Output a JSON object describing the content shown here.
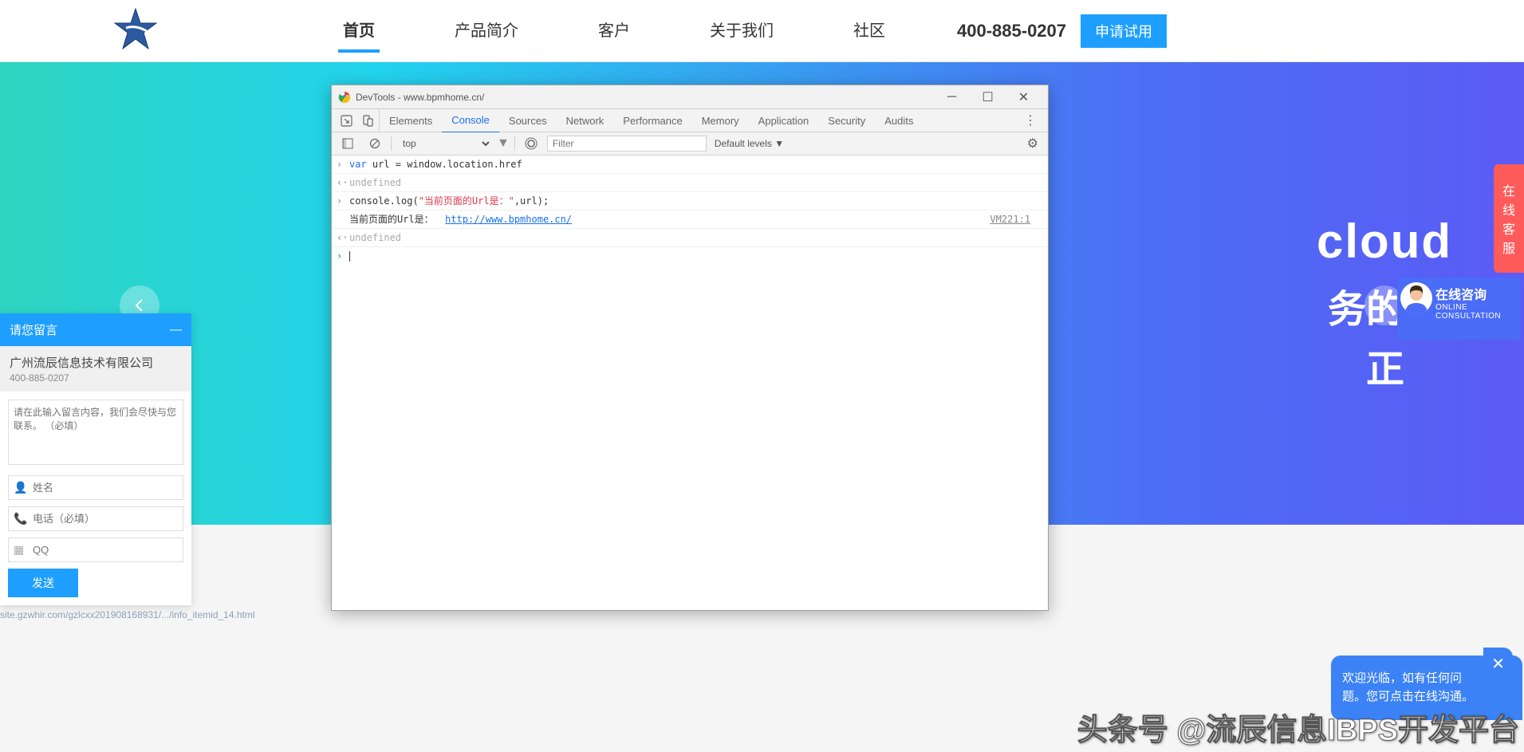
{
  "header": {
    "nav": [
      "首页",
      "产品简介",
      "客户",
      "关于我们",
      "社区"
    ],
    "phone": "400-885-0207",
    "trial": "申请试用"
  },
  "hero": {
    "line1": "cloud",
    "line2": "务的",
    "line3": "正"
  },
  "devtools": {
    "title": "DevTools - www.bpmhome.cn/",
    "tabs": [
      "Elements",
      "Console",
      "Sources",
      "Network",
      "Performance",
      "Memory",
      "Application",
      "Security",
      "Audits"
    ],
    "context": "top",
    "filter_placeholder": "Filter",
    "levels": "Default levels ▼",
    "console": {
      "line1_kw": "var",
      "line1_rest": " url = window.location.href",
      "undef": "undefined",
      "line2_a": "console.log(",
      "line2_str": "\"当前页面的Url是：\"",
      "line2_b": ",url);",
      "out_label": "当前页面的Url是：",
      "out_link": "http://www.bpmhome.cn/",
      "source": "VM221:1"
    }
  },
  "msg": {
    "title": "请您留言",
    "company": "广州流辰信息技术有限公司",
    "phone": "400-885-0207",
    "textarea_ph": "请在此输入留言内容，我们会尽快与您联系。 （必填）",
    "name_ph": "姓名",
    "tel_ph": "电话（必填）",
    "qq_ph": "QQ",
    "send": "发送",
    "footer_url": "site.gzwhir.com/gzlcxx201908168931/.../info_itemid_14.html"
  },
  "side": {
    "tab": "在线客服",
    "consult_title": "在线咨询",
    "consult_sub": "ONLINE CONSULTATION"
  },
  "chat": {
    "line1": "欢迎光临，如有任何问",
    "line2": "题。您可点击在线沟通。"
  },
  "watermark": "头条号 @流辰信息IBPS开发平台"
}
